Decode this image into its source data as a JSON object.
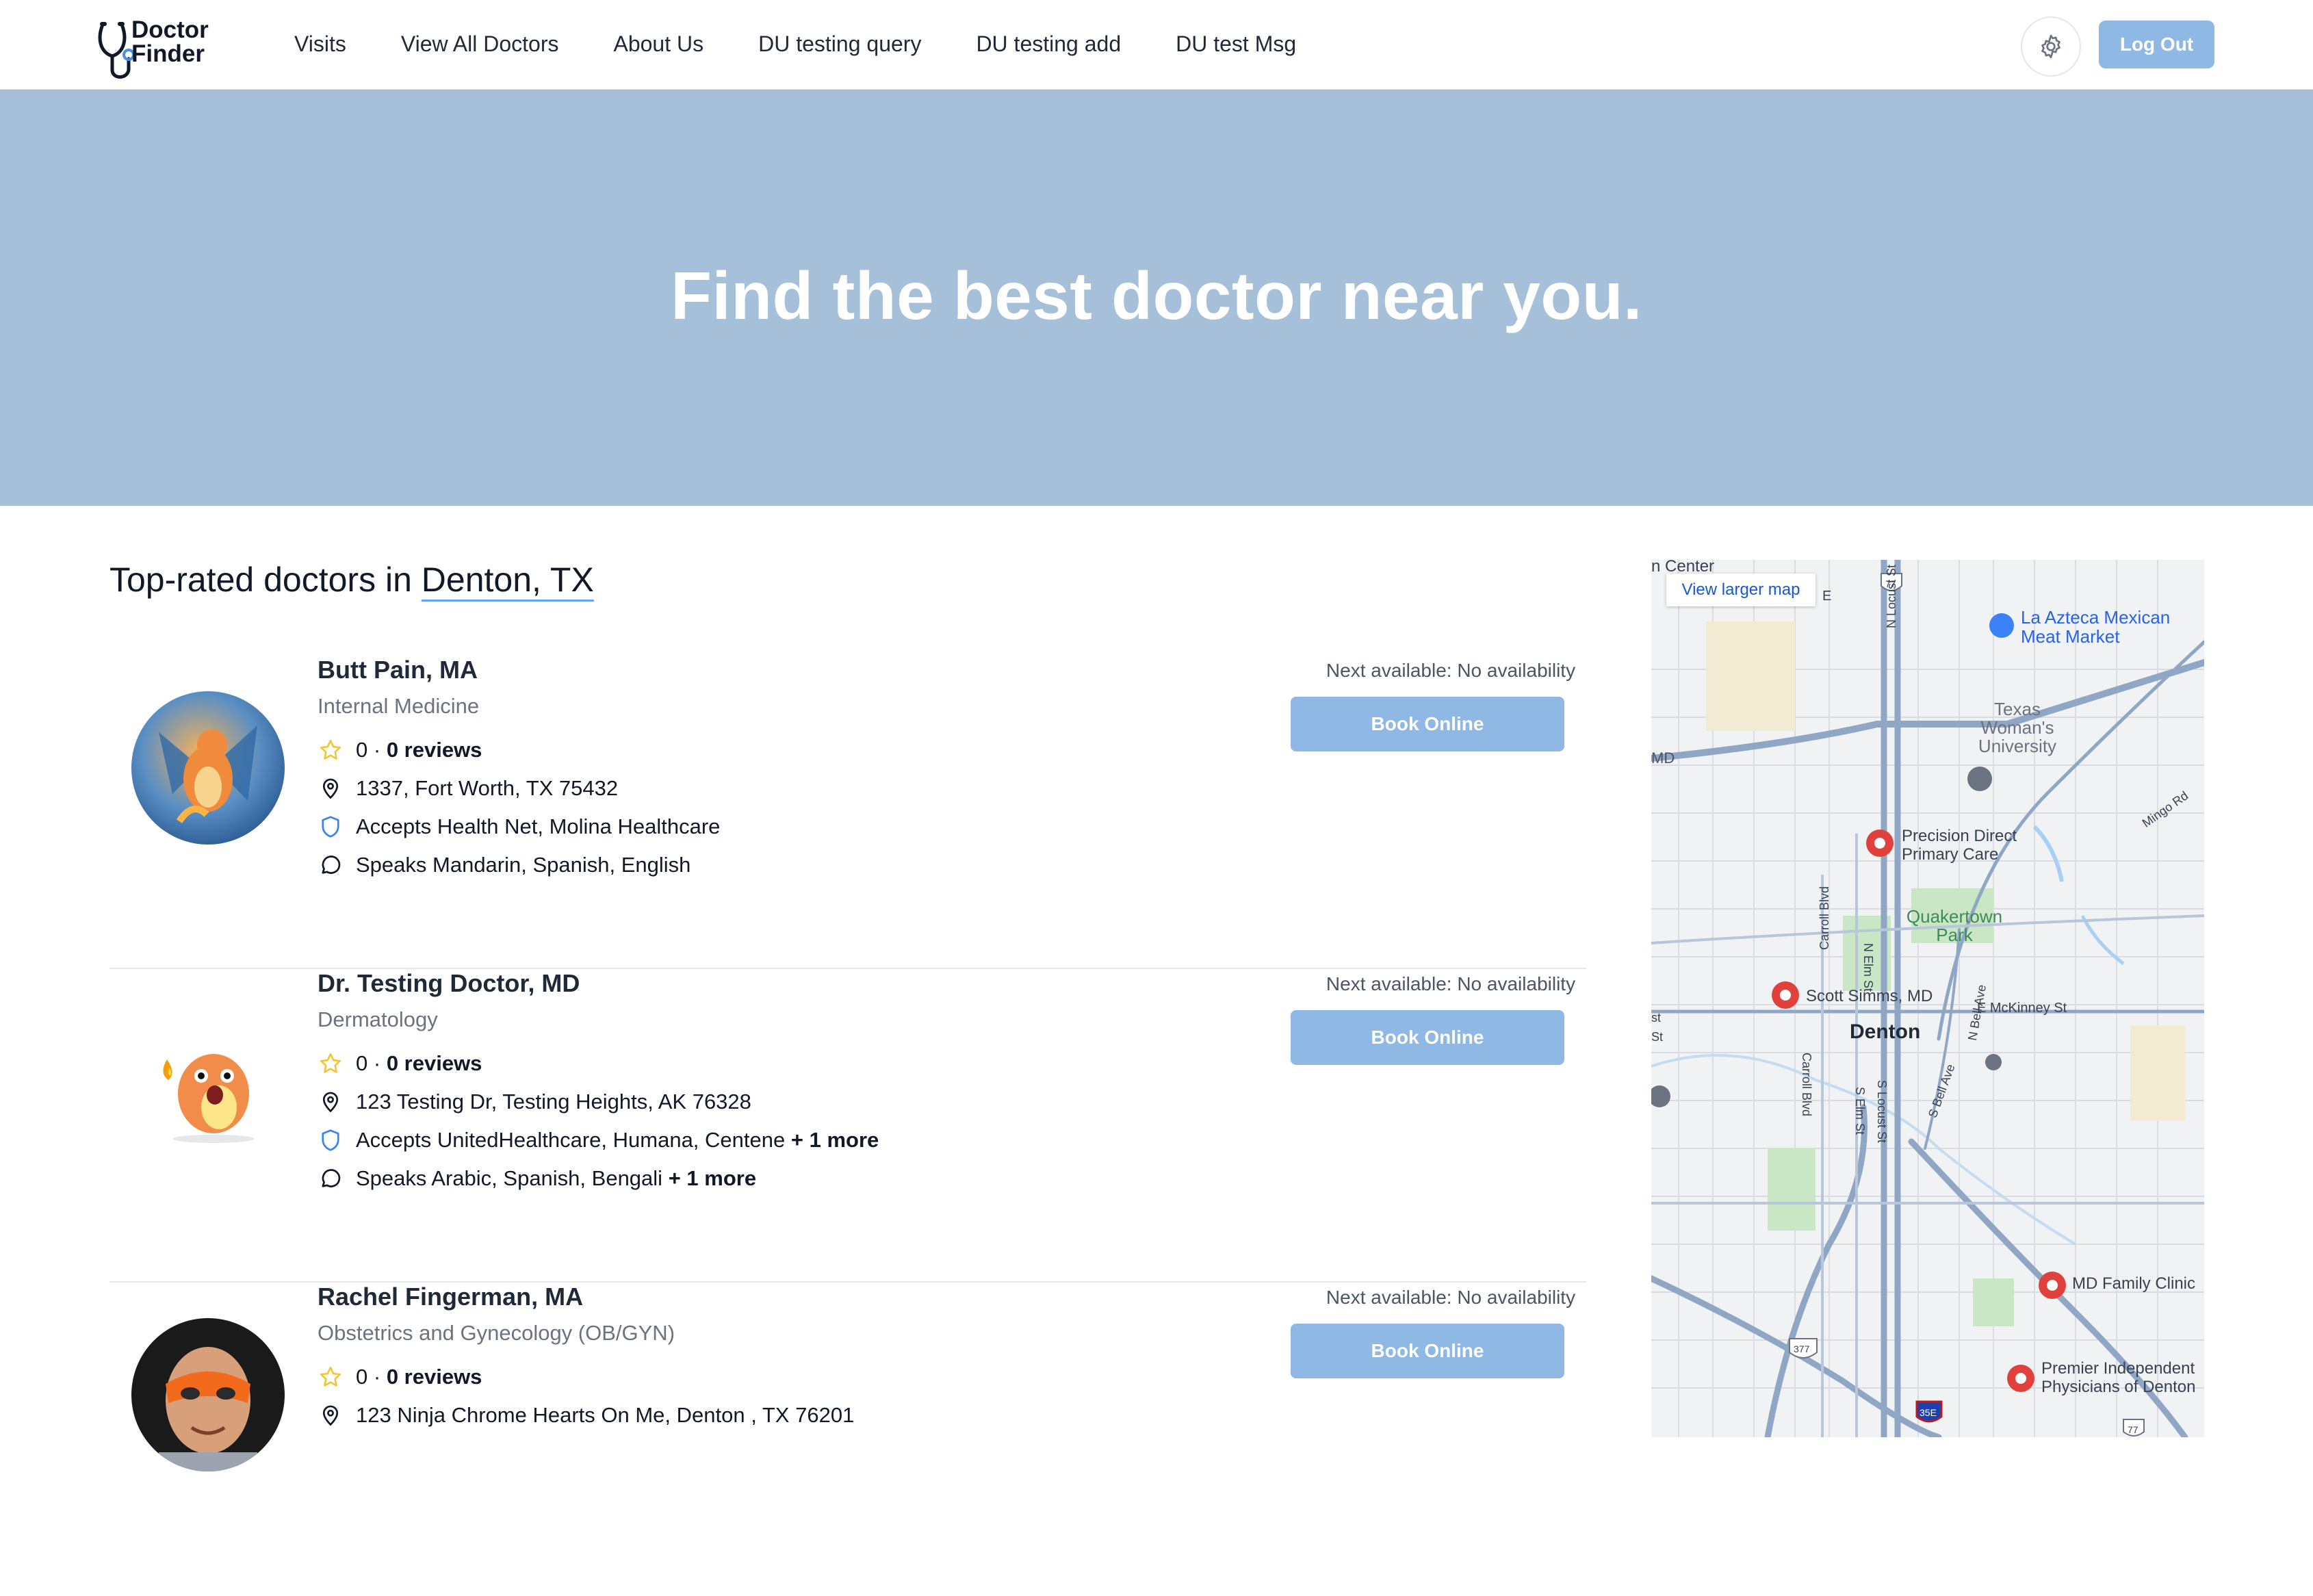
{
  "brand": {
    "line1": "Doctor",
    "line2": "Finder",
    "accent": "#4a8fe0"
  },
  "nav": {
    "links": [
      "Visits",
      "View All Doctors",
      "About Us",
      "DU testing query",
      "DU testing add",
      "DU test Msg"
    ],
    "logout": "Log Out",
    "settings_icon": "gear-icon"
  },
  "hero": {
    "title": "Find the best doctor near you.",
    "background": "#a5c0d8"
  },
  "section": {
    "title_prefix": "Top-rated doctors in ",
    "location": "Denton, TX"
  },
  "doctors": [
    {
      "name": "Butt Pain, MA",
      "specialty": "Internal Medicine",
      "rating": "0",
      "reviews": "0 reviews",
      "address": "1337, Fort Worth, TX 75432",
      "insurance": "Accepts Health Net, Molina Healthcare",
      "insurance_more": "",
      "languages": "Speaks Mandarin, Spanish, English",
      "languages_more": "",
      "availability": "Next available: No availability",
      "book": "Book Online"
    },
    {
      "name": "Dr. Testing Doctor, MD",
      "specialty": "Dermatology",
      "rating": "0",
      "reviews": "0 reviews",
      "address": "123 Testing Dr, Testing Heights, AK 76328",
      "insurance": "Accepts UnitedHealthcare, Humana, Centene",
      "insurance_more": "+ 1 more",
      "languages": "Speaks Arabic, Spanish, Bengali",
      "languages_more": "+ 1 more",
      "availability": "Next available: No availability",
      "book": "Book Online"
    },
    {
      "name": "Rachel Fingerman, MA",
      "specialty": "Obstetrics and Gynecology (OB/GYN)",
      "rating": "0",
      "reviews": "0 reviews",
      "address": "123 Ninja Chrome Hearts On Me, Denton , TX 76201",
      "availability": "Next available: No availability",
      "book": "Book Online"
    }
  ],
  "map": {
    "view_larger": "View larger map",
    "places": {
      "aztec": "La Azteca Mexican Meat Market",
      "twu": "Texas Woman's University",
      "pdpc": "Precision Direct Primary Care",
      "qpark": "Quakertown Park",
      "simms": "Scott Simms, MD",
      "denton": "Denton",
      "mdfc": "MD Family Clinic",
      "premier": "Premier Independent Physicians of Denton",
      "center": "n Center"
    },
    "streets": {
      "locust": "N Locust St",
      "elm": "N Elm St",
      "carroll_n": "Carroll Blvd",
      "carroll_s": "Carroll Blvd",
      "s_elm": "S Elm St",
      "s_locust": "S Locust St",
      "s_bell": "S Bell Ave",
      "n_bell": "N Bell Ave",
      "mckinney": "E McKinney St",
      "mingo": "Mingo Rd",
      "md": "MD",
      "e": "E",
      "st1": "st",
      "st2": "St"
    },
    "shields": [
      "77",
      "377",
      "35E",
      "77"
    ],
    "colors": {
      "road": "#8fa7c5",
      "park": "#c9e6c5",
      "water": "#a8d0f5",
      "pin": "#e0413c"
    }
  }
}
